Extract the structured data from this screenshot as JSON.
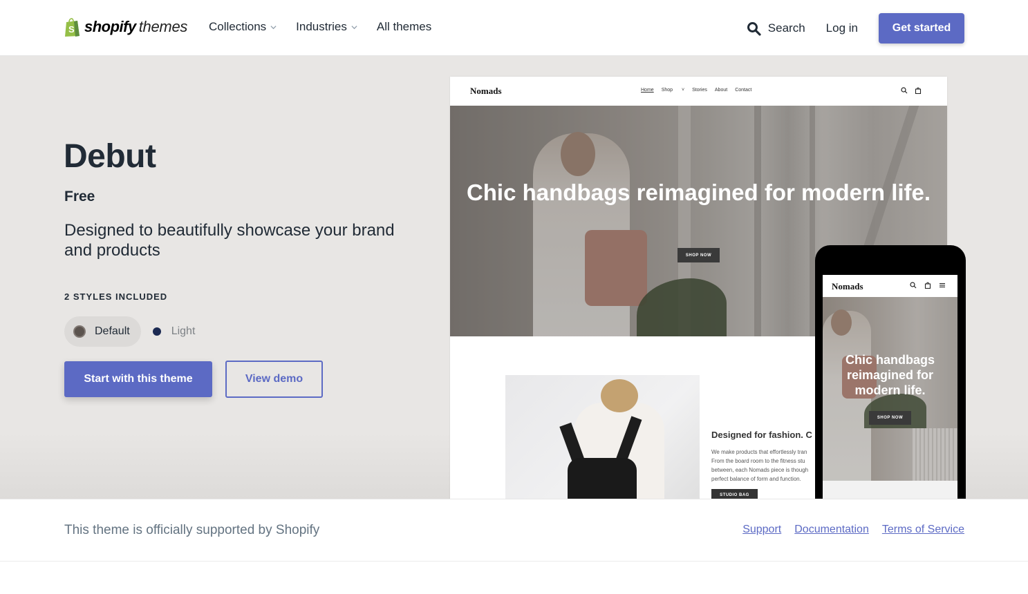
{
  "header": {
    "logo": {
      "brand": "shopify",
      "suffix": "themes",
      "icon": "shopify-bag-icon",
      "brand_color": "#95bf47"
    },
    "nav": [
      {
        "label": "Collections",
        "has_dropdown": true
      },
      {
        "label": "Industries",
        "has_dropdown": true
      },
      {
        "label": "All themes",
        "has_dropdown": false
      }
    ],
    "search_label": "Search",
    "login_label": "Log in",
    "cta_label": "Get started"
  },
  "theme": {
    "name": "Debut",
    "price": "Free",
    "description": "Designed to beautifully showcase your brand and products",
    "styles_label": "2 STYLES INCLUDED",
    "styles": [
      {
        "label": "Default",
        "color": "#5b534e",
        "selected": true
      },
      {
        "label": "Light",
        "color": "#1c2a52",
        "selected": false
      }
    ],
    "primary_button": "Start with this theme",
    "secondary_button": "View demo"
  },
  "preview": {
    "desktop": {
      "brand": "Nomads",
      "nav": [
        "Home",
        "Shop",
        "Stories",
        "About",
        "Contact"
      ],
      "headline": "Chic handbags reimagined for modern life.",
      "cta": "SHOP NOW",
      "feature_title": "Designed for fashion. C",
      "feature_lines": [
        "We make products that effortlessly tran",
        "From the board room to the fitness stu",
        "between, each Nomads piece is though",
        "perfect balance of form and function."
      ],
      "feature_cta": "STUDIO BAG"
    },
    "mobile": {
      "brand": "Nomads",
      "headline": "Chic handbags reimagined for modern life.",
      "cta": "SHOP NOW"
    }
  },
  "footer": {
    "support_text": "This theme is officially supported by Shopify",
    "links": [
      "Support",
      "Documentation",
      "Terms of Service"
    ]
  },
  "colors": {
    "accent": "#5c6ac4",
    "text": "#212b36",
    "muted": "#637381",
    "hero_bg": "#e8e6e4"
  }
}
